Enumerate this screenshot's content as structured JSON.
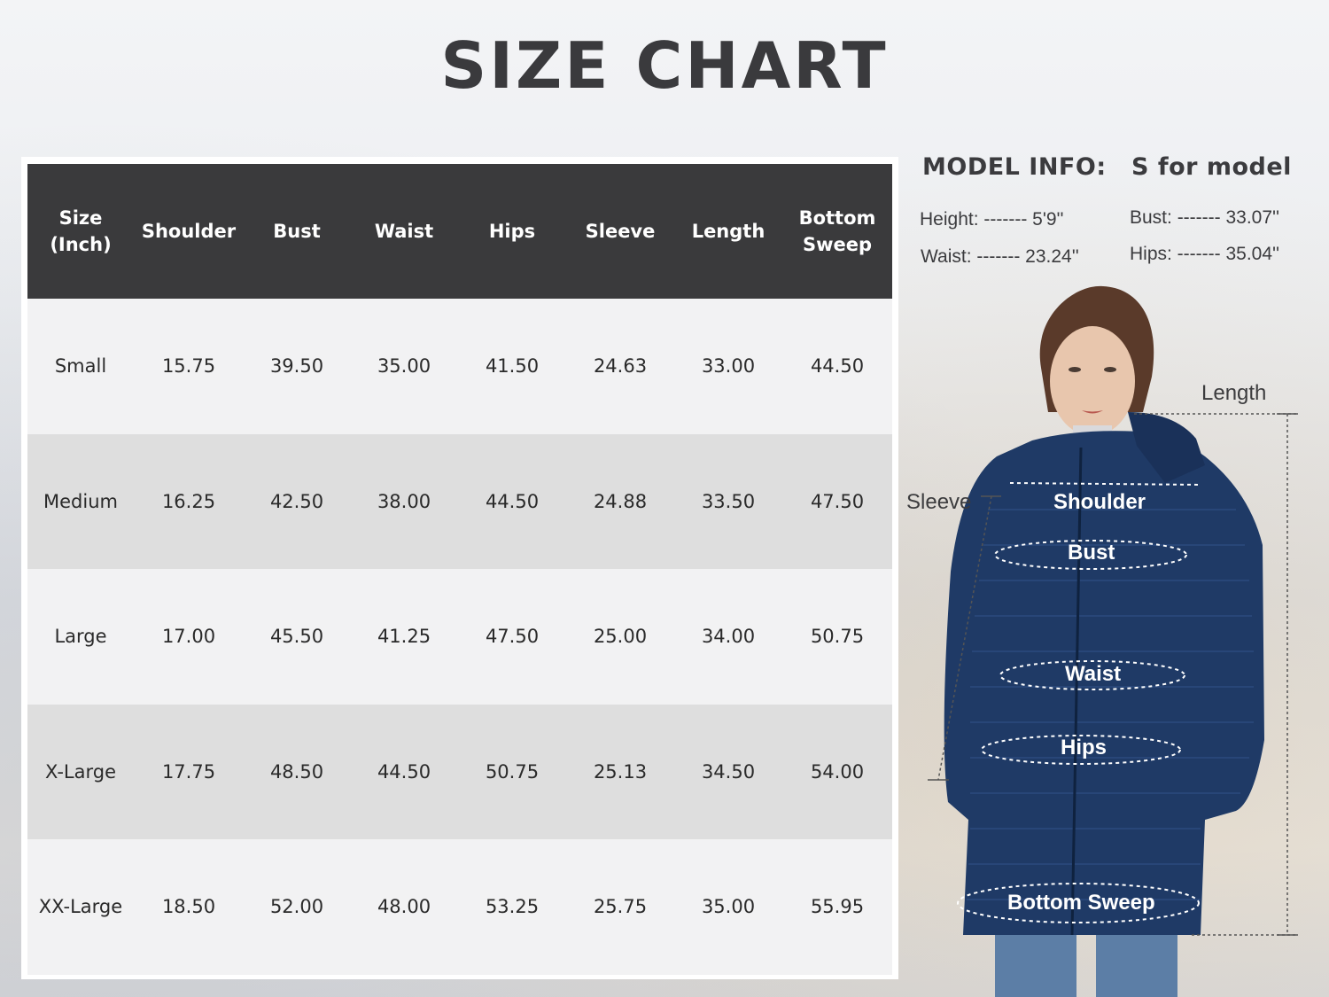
{
  "title": "SIZE CHART",
  "table": {
    "header": {
      "size_line1": "Size",
      "size_line2": "(Inch)",
      "shoulder": "Shoulder",
      "bust": "Bust",
      "waist": "Waist",
      "hips": "Hips",
      "sleeve": "Sleeve",
      "length": "Length",
      "bottom_line1": "Bottom",
      "bottom_line2": "Sweep"
    },
    "rows": [
      {
        "size": "Small",
        "shoulder": "15.75",
        "bust": "39.50",
        "waist": "35.00",
        "hips": "41.50",
        "sleeve": "24.63",
        "length": "33.00",
        "bottom": "44.50"
      },
      {
        "size": "Medium",
        "shoulder": "16.25",
        "bust": "42.50",
        "waist": "38.00",
        "hips": "44.50",
        "sleeve": "24.88",
        "length": "33.50",
        "bottom": "47.50"
      },
      {
        "size": "Large",
        "shoulder": "17.00",
        "bust": "45.50",
        "waist": "41.25",
        "hips": "47.50",
        "sleeve": "25.00",
        "length": "34.00",
        "bottom": "50.75"
      },
      {
        "size": "X-Large",
        "shoulder": "17.75",
        "bust": "48.50",
        "waist": "44.50",
        "hips": "50.75",
        "sleeve": "25.13",
        "length": "34.50",
        "bottom": "54.00"
      },
      {
        "size": "XX-Large",
        "shoulder": "18.50",
        "bust": "52.00",
        "waist": "48.00",
        "hips": "53.25",
        "sleeve": "25.75",
        "length": "35.00",
        "bottom": "55.95"
      }
    ]
  },
  "model_info": {
    "label": "MODEL INFO:",
    "size_note": "S for model",
    "height": "Height: ------- 5'9''",
    "waist": "Waist: ------- 23.24''",
    "bust": "Bust: ------- 33.07''",
    "hips": "Hips: ------- 35.04''"
  },
  "diagram": {
    "length": "Length",
    "sleeve": "Sleeve",
    "shoulder": "Shoulder",
    "bust": "Bust",
    "waist": "Waist",
    "hips": "Hips",
    "bottom_sweep": "Bottom Sweep"
  },
  "colors": {
    "header_bg": "#3a3a3c",
    "row_light": "#f2f2f3",
    "row_dark": "#dedede",
    "jacket": "#1f3a66",
    "title": "#3a3a3d"
  }
}
